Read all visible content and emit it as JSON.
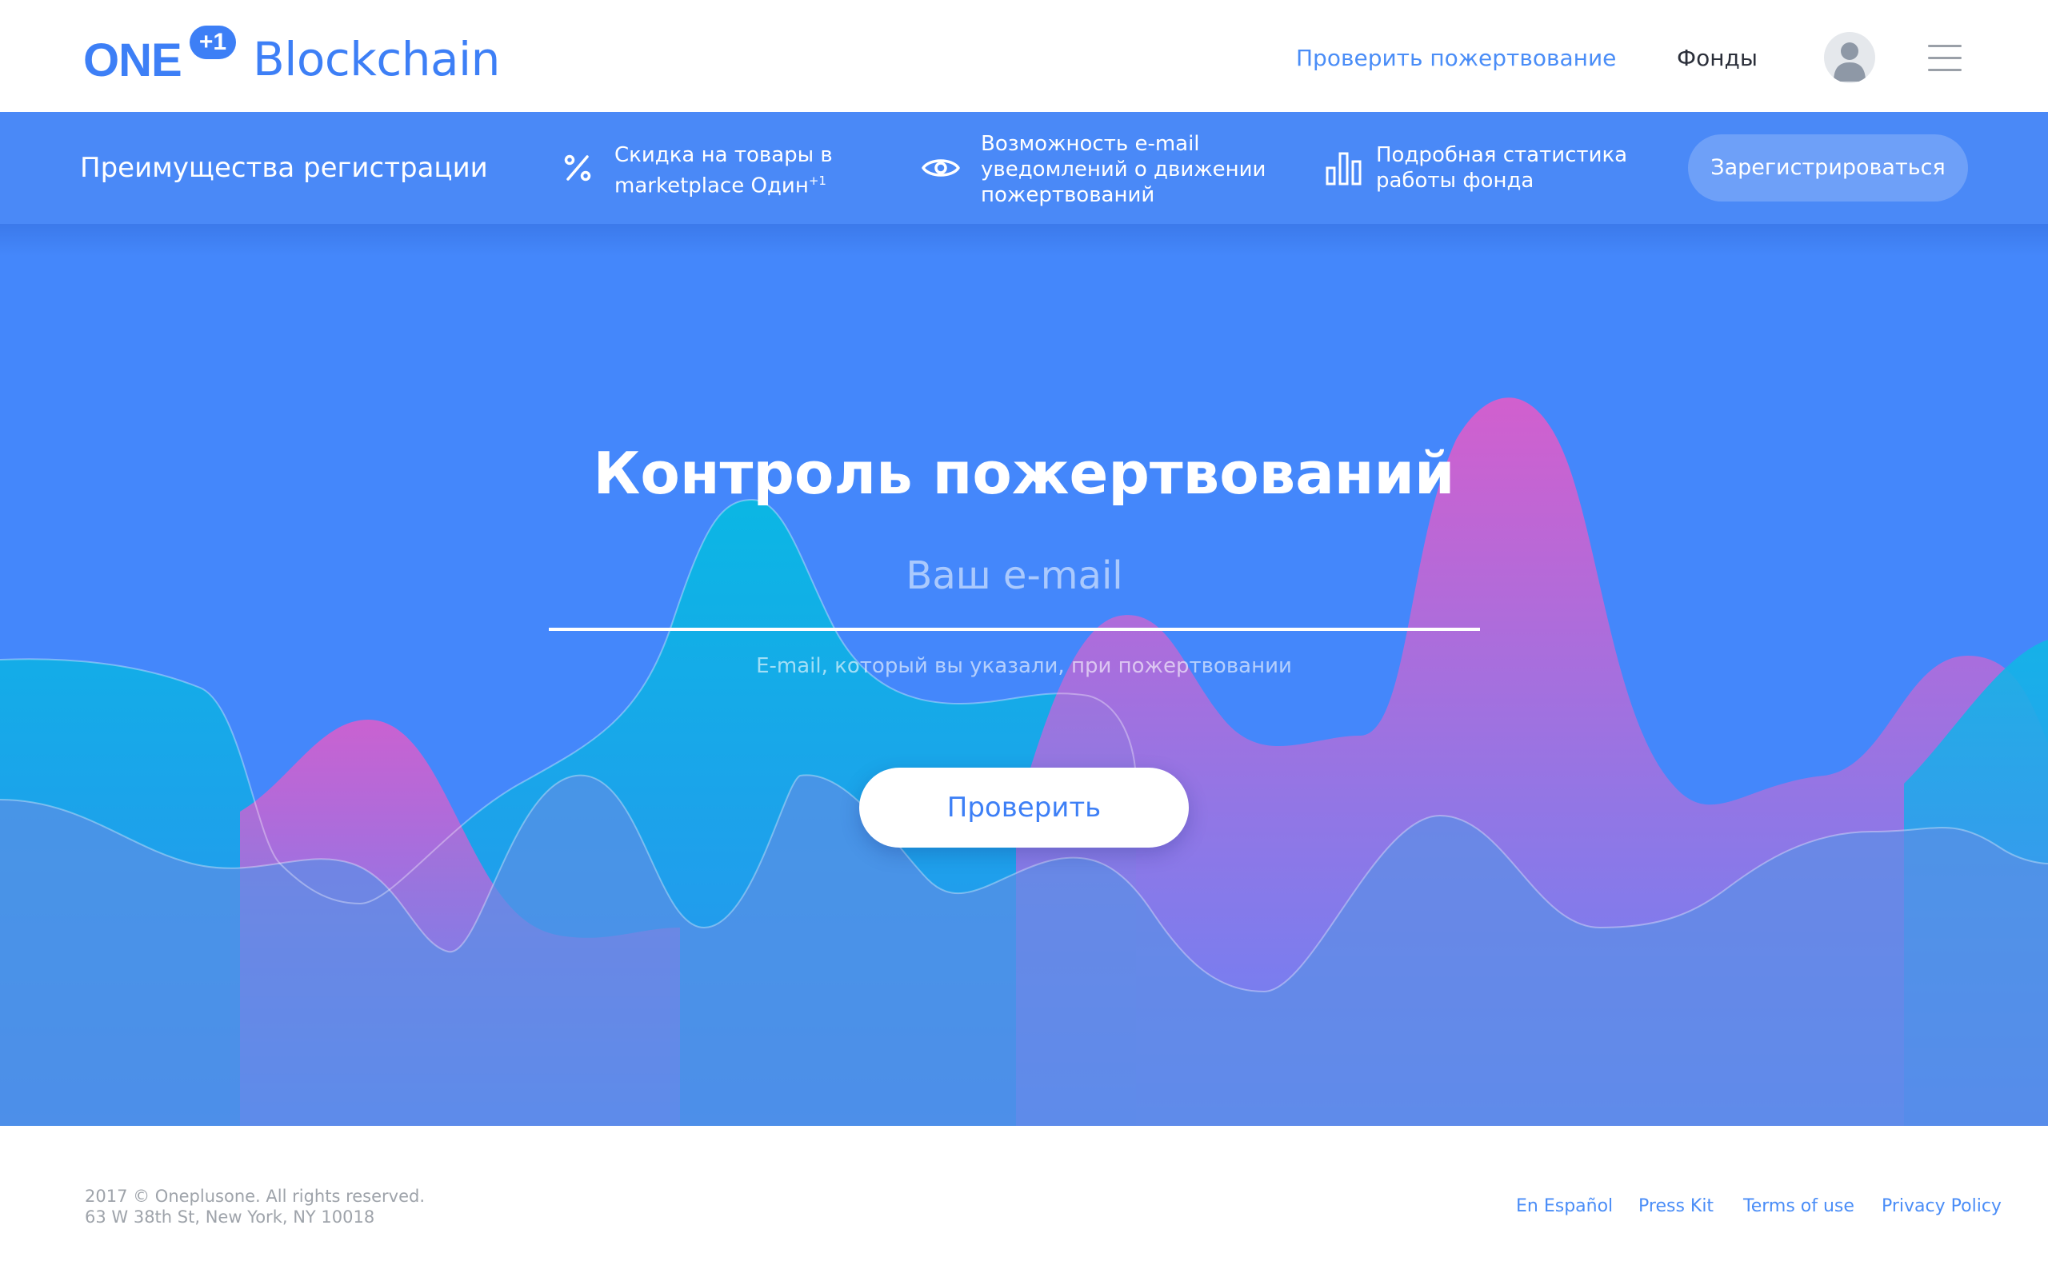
{
  "header": {
    "logo": {
      "one": "ONE",
      "badge": "+1",
      "name": "Blockchain"
    },
    "nav": {
      "check_donation": "Проверить пожертвование",
      "funds": "Фонды"
    },
    "avatar_icon": "user-avatar-icon",
    "menu_icon": "hamburger-menu-icon"
  },
  "benefits": {
    "title": "Преимущества регистрации",
    "items": [
      {
        "icon": "percent-icon",
        "line1": "Скидка на товары в",
        "line2": "marketplace Один",
        "sup": "+1"
      },
      {
        "icon": "eye-icon",
        "line1": "Возможность e-mail",
        "line2": "уведомлений о движении",
        "line3": "пожертвований"
      },
      {
        "icon": "bar-chart-icon",
        "line1": "Подробная статистика",
        "line2": "работы фонда"
      }
    ],
    "register_label": "Зарегистрироваться"
  },
  "hero": {
    "title": "Контроль пожертвований",
    "email_placeholder": "Ваш e-mail",
    "email_value": "",
    "hint": "E-mail, который вы указали, при пожертвовании",
    "check_label": "Проверить"
  },
  "footer": {
    "copyright": "2017 © Oneplusone. All rights reserved.",
    "address": "63 W 38th St, New York, NY 10018",
    "links": [
      "En Español",
      "Press Kit",
      "Terms of use",
      "Privacy Policy"
    ]
  },
  "colors": {
    "brand_blue": "#3d7ff6",
    "hero_bg": "#4487fb",
    "benefits_bg": "#4a89f7",
    "wave_cyan": "#0ab8e4",
    "wave_pink": "#d95ccc"
  }
}
